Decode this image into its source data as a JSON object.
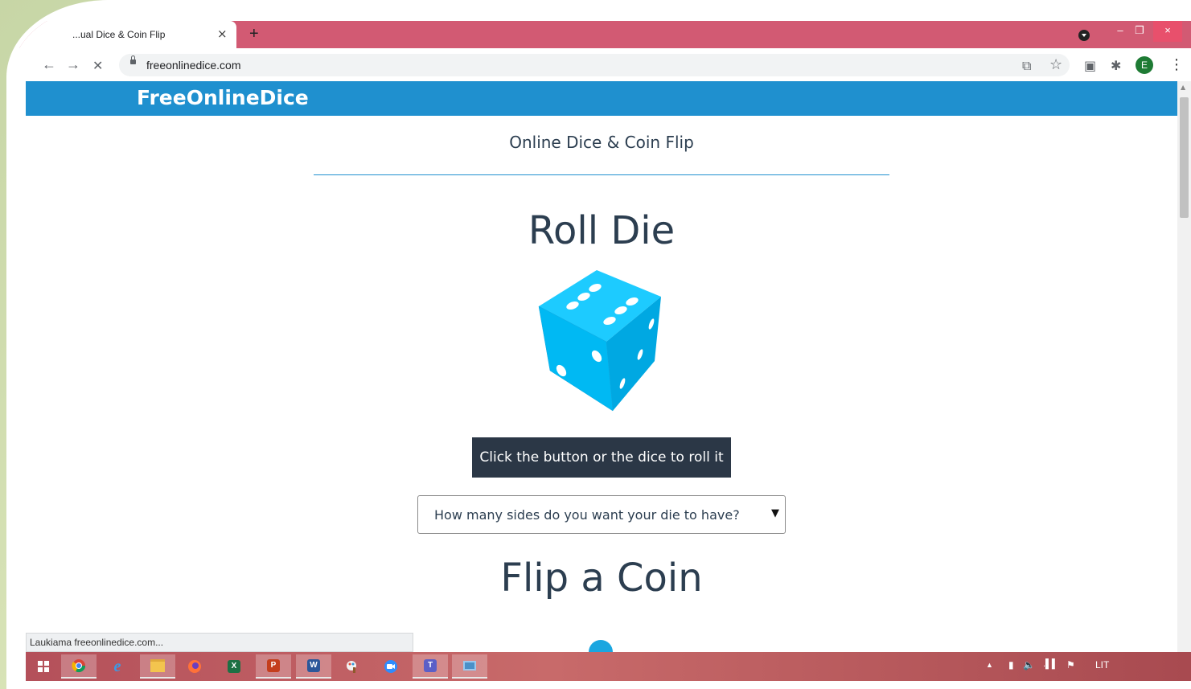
{
  "browser": {
    "tab_title": "...ual Dice & Coin Flip",
    "tab_close": "×",
    "new_tab": "+",
    "url": "freeonlinedice.com",
    "profile_initial": "E",
    "window_controls": {
      "minimize": "–",
      "restore": "❐",
      "close": "×"
    },
    "nav_icons": {
      "back": "←",
      "forward": "→",
      "stop": "✕"
    },
    "toolbar_icons": {
      "translate": "⧉",
      "bookmark": "☆",
      "pdf": "▣",
      "extensions": "✱",
      "menu": "⋮"
    }
  },
  "page": {
    "brand": "FreeOnlineDice",
    "subtitle": "Online Dice & Coin Flip",
    "roll_heading": "Roll Die",
    "roll_button": "Click the button or the dice to roll it",
    "sides_select": {
      "selected": "How many sides do you want your die to have?"
    },
    "coin_heading": "Flip a Coin",
    "colors": {
      "header": "#1f90cf",
      "die": "#00bdf7",
      "button": "#2b3746"
    }
  },
  "status_bar": "Laukiama freeonlinedice.com...",
  "taskbar": {
    "apps": [
      "start",
      "chrome",
      "edge",
      "explorer",
      "firefox",
      "excel",
      "powerpoint",
      "word",
      "paint",
      "zoom",
      "teams",
      "window"
    ],
    "excel_label": "X",
    "powerpoint_label": "P",
    "word_label": "W",
    "teams_label": "T",
    "language": "LIT"
  }
}
